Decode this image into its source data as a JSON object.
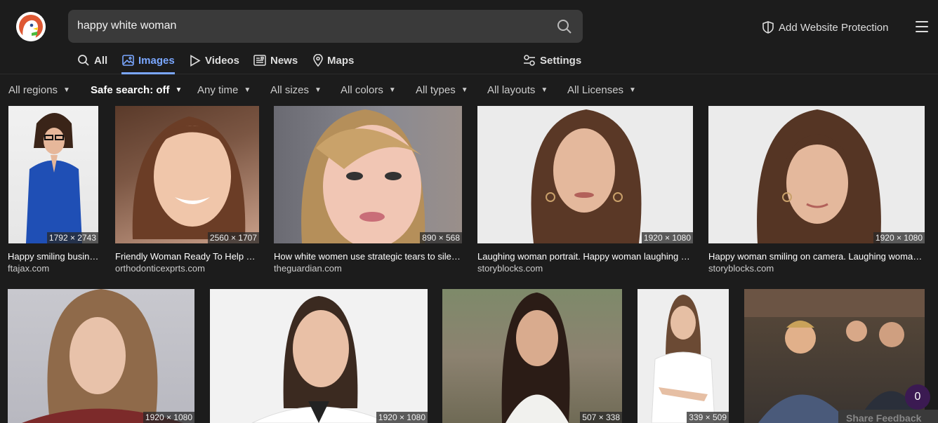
{
  "search": {
    "query": "happy white woman"
  },
  "header": {
    "protection_label": "Add Website Protection"
  },
  "tabs": [
    {
      "label": "All",
      "icon": "search-icon"
    },
    {
      "label": "Images",
      "icon": "image-icon"
    },
    {
      "label": "Videos",
      "icon": "play-icon"
    },
    {
      "label": "News",
      "icon": "newspaper-icon"
    },
    {
      "label": "Maps",
      "icon": "map-pin-icon"
    },
    {
      "label": "Settings",
      "icon": "sliders-icon"
    }
  ],
  "filters": [
    "All regions",
    "Safe search: off",
    "Any time",
    "All sizes",
    "All colors",
    "All types",
    "All layouts",
    "All Licenses"
  ],
  "results": [
    {
      "caption": "Happy smiling business woman",
      "source": "ftajax.com",
      "size": "1792 × 2743"
    },
    {
      "caption": "Friendly Woman Ready To Help You",
      "source": "orthodonticexprts.com",
      "size": "2560 × 1707"
    },
    {
      "caption": "How white women use strategic tears to silence women of colour",
      "source": "theguardian.com",
      "size": "890 × 568"
    },
    {
      "caption": "Laughing woman portrait. Happy woman laughing on camera",
      "source": "storyblocks.com",
      "size": "1920 × 1080"
    },
    {
      "caption": "Happy woman smiling on camera. Laughing woman portrait",
      "source": "storyblocks.com",
      "size": "1920 × 1080"
    },
    {
      "caption": "",
      "source": "",
      "size": "1920 × 1080"
    },
    {
      "caption": "",
      "source": "",
      "size": "1920 × 1080"
    },
    {
      "caption": "",
      "source": "",
      "size": "507 × 338"
    },
    {
      "caption": "",
      "source": "",
      "size": "339 × 509"
    },
    {
      "caption": "",
      "source": "",
      "size": ""
    }
  ],
  "feedback": {
    "label": "Share Feedback"
  },
  "badge": {
    "count": "0"
  },
  "colors": {
    "accent": "#7aa7ff",
    "background": "#1c1c1c"
  }
}
